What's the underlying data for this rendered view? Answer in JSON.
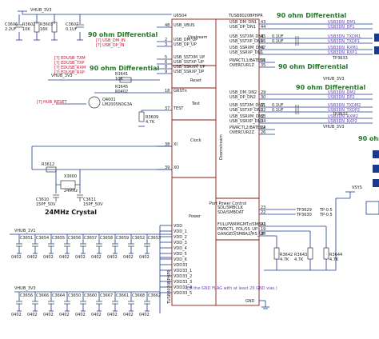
{
  "ic": {
    "ref": "U6504",
    "part": "TUSB8020BPHPR",
    "sections": {
      "upstream": "Upstream",
      "reset": "Reset",
      "test": "Test",
      "clock": "Clock",
      "power": "Power",
      "downstream": "Downstream",
      "port_power_control": "Port Power Control"
    },
    "gnd_pin": "GND",
    "gnd_pin_num": "49",
    "left_pins": [
      {
        "name": "USB_VBUS",
        "num": "48"
      },
      {
        "name": "USB_DM_UP",
        "num": "2"
      },
      {
        "name": "USB_DP_UP",
        "num": "3"
      },
      {
        "name": "USB_SSTXM_UP",
        "num": "5"
      },
      {
        "name": "USB_SSTXP_UP",
        "num": "6"
      },
      {
        "name": "USB_SSRXM_UP",
        "num": "8"
      },
      {
        "name": "USB_SSRXP_UP",
        "num": "9"
      },
      {
        "name": "GRSTn",
        "num": "18"
      },
      {
        "name": "TEST",
        "num": "37"
      },
      {
        "name": "XI",
        "num": "38"
      },
      {
        "name": "XO",
        "num": "39"
      }
    ],
    "right_pins": [
      {
        "name": "USB_DM_DN1",
        "num": "43"
      },
      {
        "name": "USB_DP_DN1",
        "num": "44"
      },
      {
        "name": "USB_SSTXM_DN1",
        "num": "45"
      },
      {
        "name": "USB_SSTXP_DN1",
        "num": "46"
      },
      {
        "name": "USB_SSRXM_DN1",
        "num": "47"
      },
      {
        "name": "USB_SSRXP_DN1",
        "num": "1"
      },
      {
        "name": "PWRCTL1/BATEN1",
        "num": "36"
      },
      {
        "name": "OVERCUR1Z",
        "num": "35"
      },
      {
        "name": "USB_DM_DN2",
        "num": "29"
      },
      {
        "name": "USB_DP_DN2",
        "num": "30"
      },
      {
        "name": "USB_SSTXM_DN2",
        "num": "31"
      },
      {
        "name": "USB_SSTXP_DN2",
        "num": "32"
      },
      {
        "name": "USB_SSRXM_DN2",
        "num": "33"
      },
      {
        "name": "USB_SSRXP_DN2",
        "num": "34"
      },
      {
        "name": "PWRCTL2/BATEN2",
        "num": "24"
      },
      {
        "name": "OVERCUR2Z",
        "num": "26"
      }
    ],
    "ppc_pins": [
      {
        "name": "SDL/SMBCLK",
        "num": "23"
      },
      {
        "name": "SDA/SMBDAT",
        "num": "22"
      },
      {
        "name": "FULLPWRMGMTz/SMBA1",
        "num": "21"
      },
      {
        "name": "PWRCTL_POL/SS_UP",
        "num": "19"
      },
      {
        "name": "GANGED/SMBA2/HS_UP",
        "num": "20"
      }
    ],
    "power_pins": [
      "VDD",
      "VDD_1",
      "VDD_2",
      "VDD_3",
      "VDD_4",
      "VDD_5",
      "VDD_6",
      "VDD33",
      "VDD33_1",
      "VDD33_2",
      "VDD33_3",
      "VDD33_4",
      "VDD33_5"
    ],
    "note": "(Fill the GND FLAG with at least 20 GND vias.)"
  },
  "diff_labels": [
    "90 ohm Differential",
    "90 ohm Differential",
    "90 ohm Differential",
    "90 ohm Differential",
    "90 ohm"
  ],
  "rails": {
    "top": "VHUB_3V3",
    "mid": "VHUB_3V3",
    "vdd11": "VHUB_1V1",
    "vdd33": "VHUB_3V3",
    "right": "VHUB_3V3",
    "vsys": "VSYS"
  },
  "upstream_parts": [
    {
      "ref": "C3606",
      "val": "2.2UF"
    },
    {
      "ref": "R3602",
      "val": "10K"
    },
    {
      "ref": "R3603",
      "val": "16K"
    },
    {
      "ref": "C3607",
      "val": "0.1UF"
    }
  ],
  "nets": {
    "usb_dm": "[?] USB_DM_IN",
    "usb_dp": "[?] USB_DP_IN",
    "ss_txm": "[?] EDUSB_TXM",
    "ss_txp": "[?] EDUSB_TXP",
    "ss_rxm": "[?] EDUSB_RXM",
    "ss_rxp": "[?] EDUSB_RXP",
    "reset": "[?] HUB_RESET",
    "tp1": "TP3633",
    "tp2": "TP3632",
    "tp3": "TP3629",
    "tp4": "TP3630"
  },
  "reset_parts": [
    {
      "ref": "R3641",
      "val": "10K"
    },
    {
      "ref": "R3645",
      "val": "R0402"
    },
    {
      "ref": "Q4001",
      "val": "LM2005N0G3A"
    },
    {
      "ref": "R3609",
      "val": "4.7K"
    }
  ],
  "crystal": {
    "ref": "X3600",
    "part": "24MHz",
    "label": "24MHz Crystal",
    "resistor": "R3612",
    "caps": [
      {
        "ref": "C3610",
        "val": "15PF_50V"
      },
      {
        "ref": "C3611",
        "val": "15PF_50V"
      }
    ]
  },
  "vdd11_caps": [
    "C3651",
    "C3654",
    "C3655",
    "C3656",
    "C3657",
    "C3658",
    "C3659",
    "C3652",
    "C3653"
  ],
  "vdd33_caps": [
    "C3656",
    "C3666",
    "C3664",
    "C3650",
    "C3660",
    "C3667",
    "C3661",
    "C3668",
    "C3662"
  ],
  "ppc_parts": [
    {
      "ref": "R3642",
      "val": "4.7K"
    },
    {
      "ref": "R3643",
      "val": "4.7K"
    },
    {
      "ref": "R3644",
      "val": "4.7K"
    }
  ],
  "dn_nets": [
    "USB3DN_DM1",
    "USB3DN_DP1",
    "USB3DN_TXDM1",
    "USB3DN_TXDP1",
    "USB3DN_RXM1",
    "USB3DN_RXP1",
    "USB3DN_DM2",
    "USB3DN_DP2",
    "USB3DN_TXDM2",
    "USB3DN_TXDP2",
    "USB3DN_RXM2",
    "USB3DN_RXP2"
  ],
  "gnd_symbol": "GND",
  "cap_small": "0402",
  "cap_val": "0.1UF",
  "tp_vals": [
    "TP-0.5",
    "TP-0.5"
  ]
}
